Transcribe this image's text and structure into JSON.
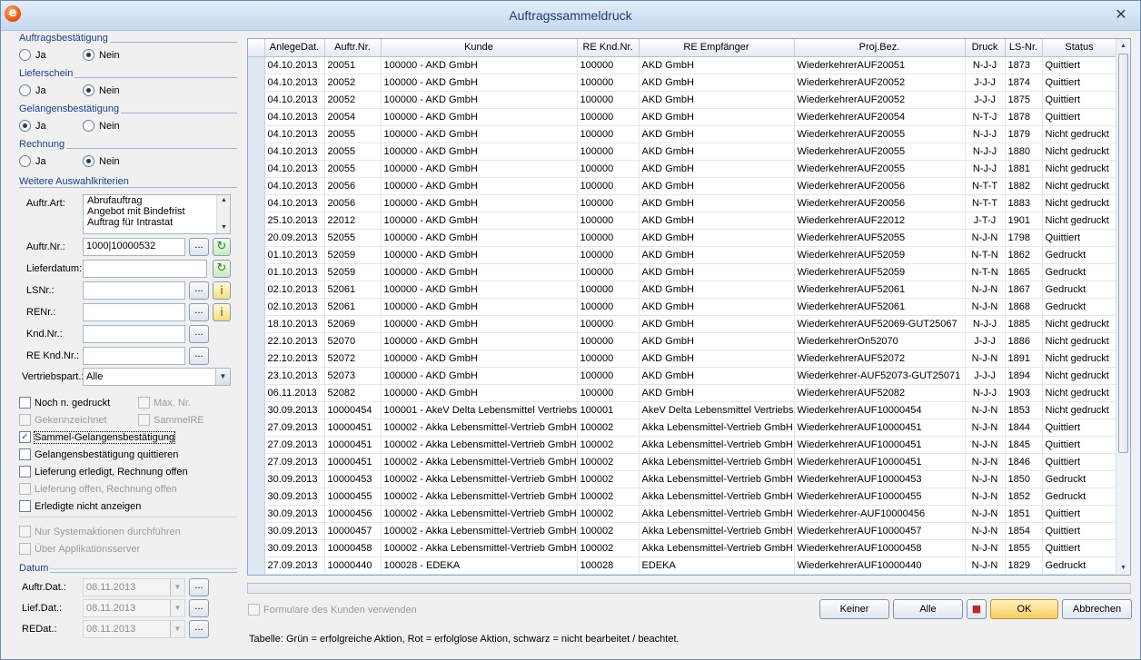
{
  "window": {
    "title": "Auftragssammeldruck",
    "close_glyph": "✕",
    "app_icon_letter": "e",
    "app_icon": "app-logo-icon"
  },
  "left": {
    "groups": [
      {
        "label": "Auftragsbestätigung",
        "options": [
          "Ja",
          "Nein"
        ],
        "selected": "Nein"
      },
      {
        "label": "Lieferschein",
        "options": [
          "Ja",
          "Nein"
        ],
        "selected": "Nein"
      },
      {
        "label": "Gelangensbestätigung",
        "options": [
          "Ja",
          "Nein"
        ],
        "selected": "Ja"
      },
      {
        "label": "Rechnung",
        "options": [
          "Ja",
          "Nein"
        ],
        "selected": "Nein"
      }
    ],
    "weitere_label": "Weitere Auswahlkriterien",
    "auftr_art": {
      "label": "Auftr.Art:",
      "items": [
        "Abrufauftrag",
        "Angebot mit Bindefrist",
        "Auftrag für Intrastat"
      ]
    },
    "auftr_nr": {
      "label": "Auftr.Nr.:",
      "value": "1000|10000532"
    },
    "lieferdatum": {
      "label": "Lieferdatum:",
      "value": ""
    },
    "ls_nr": {
      "label": "LSNr.:",
      "value": ""
    },
    "re_nr": {
      "label": "RENr.:",
      "value": ""
    },
    "knd_nr": {
      "label": "Knd.Nr.:",
      "value": ""
    },
    "re_knd_nr": {
      "label": "RE Knd.Nr.:",
      "value": ""
    },
    "vertriebspart": {
      "label": "Vertriebspart.:",
      "value": "Alle"
    },
    "dots": "...",
    "refresh_glyph": "↻",
    "info_glyph": "i",
    "checks": {
      "noch_n_gedruckt": {
        "label": "Noch n. gedruckt",
        "checked": false
      },
      "max_nr": {
        "label": "Max. Nr.",
        "checked": false
      },
      "gekennzeichnet": {
        "label": "Gekennzeichnet",
        "checked": false
      },
      "sammel_re": {
        "label": "SammelRE",
        "checked": false
      },
      "sammel_gelangens": {
        "label": "Sammel-Gelangensbestätigung",
        "checked": true
      },
      "gelangens_quittieren": {
        "label": "Gelangensbestätigung quittieren",
        "checked": false
      },
      "lieferung_erledigt": {
        "label": "Lieferung erledigt, Rechnung offen",
        "checked": false
      },
      "lieferung_offen": {
        "label": "Lieferung offen, Rechnung offen",
        "checked": false
      },
      "erledigte_nicht": {
        "label": "Erledigte nicht anzeigen",
        "checked": false
      },
      "nur_system": {
        "label": "Nur Systemaktionen durchführen",
        "checked": false
      },
      "ueber_app": {
        "label": "Über Applikationsserver",
        "checked": false
      }
    },
    "check_glyph": "✓",
    "datum": {
      "label": "Datum",
      "auftr_dat": {
        "label": "Auftr.Dat.:",
        "value": "08.11.2013"
      },
      "lief_dat": {
        "label": "Lief.Dat.:",
        "value": "08.11.2013"
      },
      "re_dat": {
        "label": "REDat.:",
        "value": "08.11.2013"
      }
    }
  },
  "table": {
    "columns": [
      "AnlegeDat.",
      "Auftr.Nr.",
      "Kunde",
      "RE Knd.Nr.",
      "RE Empfänger",
      "Proj.Bez.",
      "Druck",
      "LS-Nr.",
      "Status"
    ],
    "rows": [
      [
        "04.10.2013",
        "20051",
        "100000 - AKD GmbH",
        "100000",
        "AKD GmbH",
        "WiederkehrerAUF20051",
        "N-J-J",
        "1873",
        "Quittiert"
      ],
      [
        "04.10.2013",
        "20052",
        "100000 - AKD GmbH",
        "100000",
        "AKD GmbH",
        "WiederkehrerAUF20052",
        "J-J-J",
        "1874",
        "Quittiert"
      ],
      [
        "04.10.2013",
        "20052",
        "100000 - AKD GmbH",
        "100000",
        "AKD GmbH",
        "WiederkehrerAUF20052",
        "J-J-J",
        "1875",
        "Quittiert"
      ],
      [
        "04.10.2013",
        "20054",
        "100000 - AKD GmbH",
        "100000",
        "AKD GmbH",
        "WiederkehrerAUF20054",
        "N-T-J",
        "1878",
        "Quittiert"
      ],
      [
        "04.10.2013",
        "20055",
        "100000 - AKD GmbH",
        "100000",
        "AKD GmbH",
        "WiederkehrerAUF20055",
        "N-J-J",
        "1879",
        "Nicht gedruckt"
      ],
      [
        "04.10.2013",
        "20055",
        "100000 - AKD GmbH",
        "100000",
        "AKD GmbH",
        "WiederkehrerAUF20055",
        "N-J-J",
        "1880",
        "Nicht gedruckt"
      ],
      [
        "04.10.2013",
        "20055",
        "100000 - AKD GmbH",
        "100000",
        "AKD GmbH",
        "WiederkehrerAUF20055",
        "N-J-J",
        "1881",
        "Nicht gedruckt"
      ],
      [
        "04.10.2013",
        "20056",
        "100000 - AKD GmbH",
        "100000",
        "AKD GmbH",
        "WiederkehrerAUF20056",
        "N-T-T",
        "1882",
        "Nicht gedruckt"
      ],
      [
        "04.10.2013",
        "20056",
        "100000 - AKD GmbH",
        "100000",
        "AKD GmbH",
        "WiederkehrerAUF20056",
        "N-T-T",
        "1883",
        "Nicht gedruckt"
      ],
      [
        "25.10.2013",
        "22012",
        "100000 - AKD GmbH",
        "100000",
        "AKD GmbH",
        "WiederkehrerAUF22012",
        "J-T-J",
        "1901",
        "Nicht gedruckt"
      ],
      [
        "20.09.2013",
        "52055",
        "100000 - AKD GmbH",
        "100000",
        "AKD GmbH",
        "WiederkehrerAUF52055",
        "N-J-N",
        "1798",
        "Quittiert"
      ],
      [
        "01.10.2013",
        "52059",
        "100000 - AKD GmbH",
        "100000",
        "AKD GmbH",
        "WiederkehrerAUF52059",
        "N-T-N",
        "1862",
        "Gedruckt"
      ],
      [
        "01.10.2013",
        "52059",
        "100000 - AKD GmbH",
        "100000",
        "AKD GmbH",
        "WiederkehrerAUF52059",
        "N-T-N",
        "1865",
        "Gedruckt"
      ],
      [
        "02.10.2013",
        "52061",
        "100000 - AKD GmbH",
        "100000",
        "AKD GmbH",
        "WiederkehrerAUF52061",
        "N-J-N",
        "1867",
        "Gedruckt"
      ],
      [
        "02.10.2013",
        "52061",
        "100000 - AKD GmbH",
        "100000",
        "AKD GmbH",
        "WiederkehrerAUF52061",
        "N-J-N",
        "1868",
        "Gedruckt"
      ],
      [
        "18.10.2013",
        "52069",
        "100000 - AKD GmbH",
        "100000",
        "AKD GmbH",
        "WiederkehrerAUF52069-GUT25067",
        "N-J-J",
        "1885",
        "Nicht gedruckt"
      ],
      [
        "22.10.2013",
        "52070",
        "100000 - AKD GmbH",
        "100000",
        "AKD GmbH",
        "WiederkehrerOn52070",
        "J-J-J",
        "1886",
        "Nicht gedruckt"
      ],
      [
        "22.10.2013",
        "52072",
        "100000 - AKD GmbH",
        "100000",
        "AKD GmbH",
        "WiederkehrerAUF52072",
        "N-J-N",
        "1891",
        "Nicht gedruckt"
      ],
      [
        "23.10.2013",
        "52073",
        "100000 - AKD GmbH",
        "100000",
        "AKD GmbH",
        "Wiederkehrer-AUF52073-GUT25071",
        "J-J-J",
        "1894",
        "Nicht gedruckt"
      ],
      [
        "06.11.2013",
        "52082",
        "100000 - AKD GmbH",
        "100000",
        "AKD GmbH",
        "WiederkehrerAUF52082",
        "N-J-J",
        "1903",
        "Nicht gedruckt"
      ],
      [
        "30.09.2013",
        "10000454",
        "100001 - AkeV Delta Lebensmittel Vertriebs",
        "100001",
        "AkeV Delta Lebensmittel Vertriebs",
        "WiederkehrerAUF10000454",
        "N-J-N",
        "1853",
        "Nicht gedruckt"
      ],
      [
        "27.09.2013",
        "10000451",
        "100002 - Akka Lebensmittel-Vertrieb GmbH",
        "100002",
        "Akka Lebensmittel-Vertrieb GmbH",
        "WiederkehrerAUF10000451",
        "N-J-N",
        "1844",
        "Quittiert"
      ],
      [
        "27.09.2013",
        "10000451",
        "100002 - Akka Lebensmittel-Vertrieb GmbH",
        "100002",
        "Akka Lebensmittel-Vertrieb GmbH",
        "WiederkehrerAUF10000451",
        "N-J-N",
        "1845",
        "Quittiert"
      ],
      [
        "27.09.2013",
        "10000451",
        "100002 - Akka Lebensmittel-Vertrieb GmbH",
        "100002",
        "Akka Lebensmittel-Vertrieb GmbH",
        "WiederkehrerAUF10000451",
        "N-J-N",
        "1846",
        "Quittiert"
      ],
      [
        "30.09.2013",
        "10000453",
        "100002 - Akka Lebensmittel-Vertrieb GmbH",
        "100002",
        "Akka Lebensmittel-Vertrieb GmbH",
        "WiederkehrerAUF10000453",
        "N-J-N",
        "1850",
        "Gedruckt"
      ],
      [
        "30.09.2013",
        "10000455",
        "100002 - Akka Lebensmittel-Vertrieb GmbH",
        "100002",
        "Akka Lebensmittel-Vertrieb GmbH",
        "WiederkehrerAUF10000455",
        "N-J-N",
        "1852",
        "Gedruckt"
      ],
      [
        "30.09.2013",
        "10000456",
        "100002 - Akka Lebensmittel-Vertrieb GmbH",
        "100002",
        "Akka Lebensmittel-Vertrieb GmbH",
        "Wiederkehrer-AUF10000456",
        "N-J-N",
        "1851",
        "Quittiert"
      ],
      [
        "30.09.2013",
        "10000457",
        "100002 - Akka Lebensmittel-Vertrieb GmbH",
        "100002",
        "Akka Lebensmittel-Vertrieb GmbH",
        "WiederkehrerAUF10000457",
        "N-J-N",
        "1854",
        "Quittiert"
      ],
      [
        "30.09.2013",
        "10000458",
        "100002 - Akka Lebensmittel-Vertrieb GmbH",
        "100002",
        "Akka Lebensmittel-Vertrieb GmbH",
        "WiederkehrerAUF10000458",
        "N-J-N",
        "1855",
        "Quittiert"
      ],
      [
        "27.09.2013",
        "10000440",
        "100028 - EDEKA",
        "100028",
        "EDEKA",
        "WiederkehrerAUF10000440",
        "N-J-N",
        "1829",
        "Gedruckt"
      ]
    ]
  },
  "bottom": {
    "formulare_label": "Formulare des Kunden verwenden",
    "buttons": {
      "keiner": "Keiner",
      "alle": "Alle",
      "ok": "OK",
      "abbrechen": "Abbrechen"
    },
    "legend": "Tabelle: Grün = erfolgreiche Aktion, Rot = erfolglose Aktion, schwarz = nicht bearbeitet / beachtet."
  },
  "colors": {
    "accent": "#1a3e8a",
    "ok_button": "#f7cd5e",
    "title_text": "#1e3d6e"
  }
}
